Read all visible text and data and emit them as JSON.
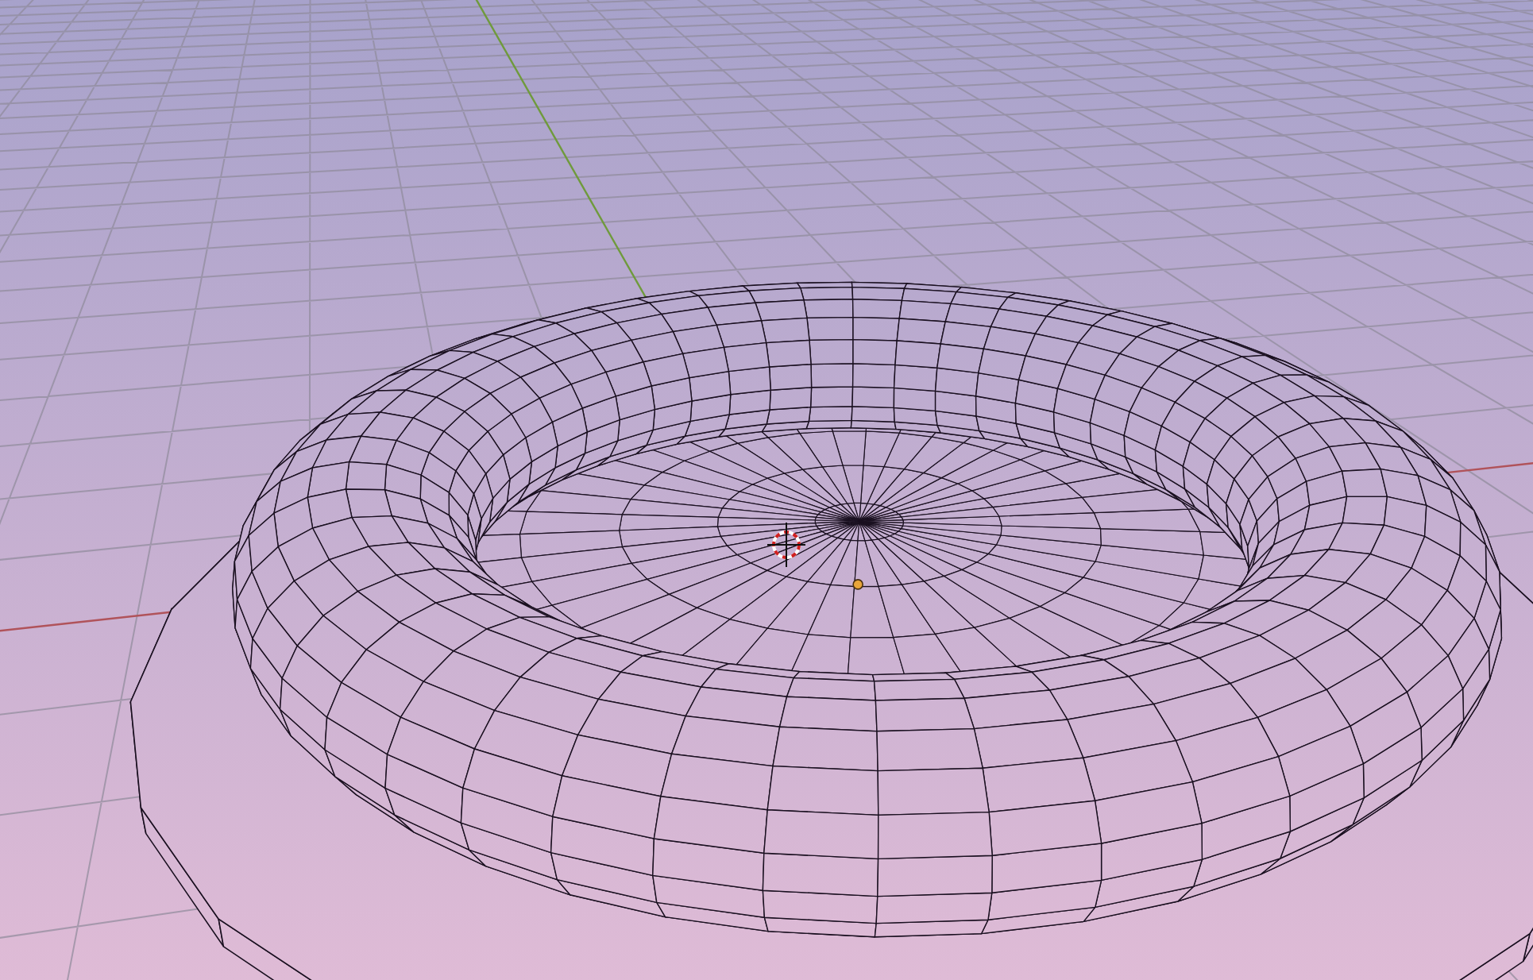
{
  "viewport": {
    "objects": [
      {
        "kind": "disc"
      },
      {
        "kind": "torus"
      },
      {
        "kind": "origin-point"
      },
      {
        "kind": "cursor"
      }
    ]
  }
}
